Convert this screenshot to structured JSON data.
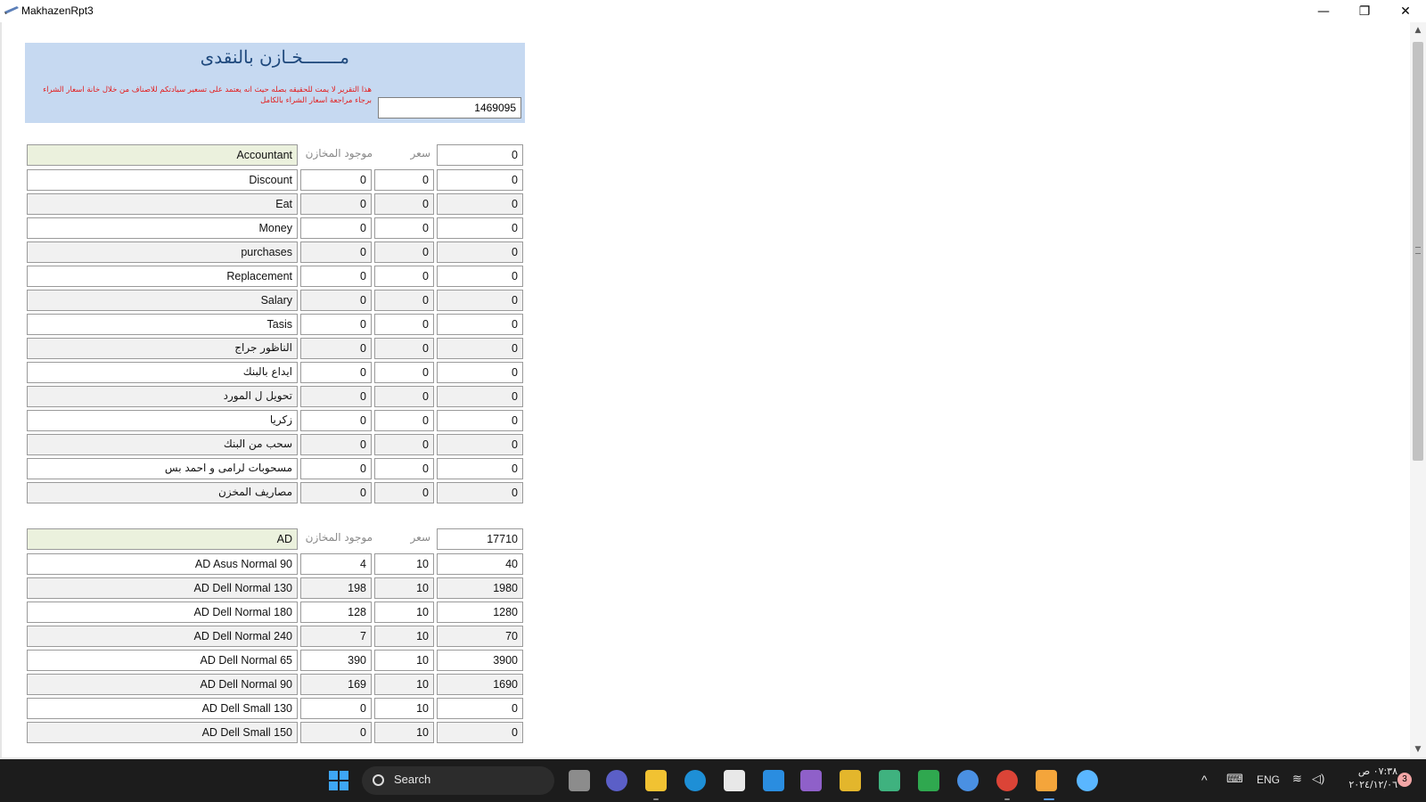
{
  "window": {
    "title": "MakhazenRpt3",
    "minimize": "—",
    "maximize": "❐",
    "close": "✕"
  },
  "report": {
    "title": "مـــــــخـازن بالنقدى",
    "note": "هذا التقرير لا يمت للحقيقه بصله حيث انه يعتمد على تسعير سيادتكم للاصناف من خلال خانة اسعار الشراء برجاء مراجعة اسعار الشراء بالكامل",
    "grand_total": "1469095"
  },
  "labels": {
    "qty": "موجود المخازن",
    "price": "سعر"
  },
  "groups": [
    {
      "name": "Accountant",
      "total": "0",
      "rows": [
        {
          "name": "Discount",
          "qty": "0",
          "price": "0",
          "total": "0"
        },
        {
          "name": "Eat",
          "qty": "0",
          "price": "0",
          "total": "0"
        },
        {
          "name": "Money",
          "qty": "0",
          "price": "0",
          "total": "0"
        },
        {
          "name": "purchases",
          "qty": "0",
          "price": "0",
          "total": "0"
        },
        {
          "name": "Replacement",
          "qty": "0",
          "price": "0",
          "total": "0"
        },
        {
          "name": "Salary",
          "qty": "0",
          "price": "0",
          "total": "0"
        },
        {
          "name": "Tasis",
          "qty": "0",
          "price": "0",
          "total": "0"
        },
        {
          "name": "الناظور جراج",
          "qty": "0",
          "price": "0",
          "total": "0"
        },
        {
          "name": "ايداع بالبنك",
          "qty": "0",
          "price": "0",
          "total": "0"
        },
        {
          "name": "تحويل ل المورد",
          "qty": "0",
          "price": "0",
          "total": "0"
        },
        {
          "name": "زكريا",
          "qty": "0",
          "price": "0",
          "total": "0"
        },
        {
          "name": "سحب من البنك",
          "qty": "0",
          "price": "0",
          "total": "0"
        },
        {
          "name": "مسحوبات لرامى و احمد بس",
          "qty": "0",
          "price": "0",
          "total": "0"
        },
        {
          "name": "مصاريف المخزن",
          "qty": "0",
          "price": "0",
          "total": "0"
        }
      ]
    },
    {
      "name": "AD",
      "total": "17710",
      "rows": [
        {
          "name": "AD Asus Normal 90",
          "qty": "4",
          "price": "10",
          "total": "40"
        },
        {
          "name": "AD Dell Normal 130",
          "qty": "198",
          "price": "10",
          "total": "1980"
        },
        {
          "name": "AD Dell Normal 180",
          "qty": "128",
          "price": "10",
          "total": "1280"
        },
        {
          "name": "AD Dell Normal 240",
          "qty": "7",
          "price": "10",
          "total": "70"
        },
        {
          "name": "AD Dell Normal 65",
          "qty": "390",
          "price": "10",
          "total": "3900"
        },
        {
          "name": "AD Dell Normal 90",
          "qty": "169",
          "price": "10",
          "total": "1690"
        },
        {
          "name": "AD Dell Small 130",
          "qty": "0",
          "price": "10",
          "total": "0"
        },
        {
          "name": "AD Dell Small 150",
          "qty": "0",
          "price": "10",
          "total": "0"
        }
      ]
    }
  ],
  "taskbar": {
    "search_label": "Search",
    "language": "ENG",
    "clock_time": "٠٧:٣٨ ص",
    "clock_date": "٢٠٢٤/١٢/٠٦",
    "notifications": "3"
  },
  "colors": {
    "header_bg": "#c6d9f1",
    "title_color": "#1f497d",
    "note_color": "#e31b1b",
    "group_bg": "#ebf1dd"
  }
}
